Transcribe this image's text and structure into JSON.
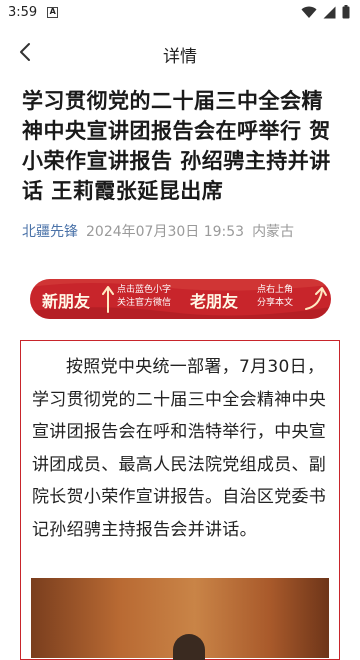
{
  "status_bar": {
    "time": "3:59",
    "notification_icon_letter": "A",
    "icons": [
      "wifi-icon",
      "signal-icon",
      "battery-icon"
    ]
  },
  "nav": {
    "title": "详情",
    "back_icon": "chevron-left-icon"
  },
  "article": {
    "title": "学习贯彻党的二十届三中全会精神中央宣讲团报告会在呼举行 贺小荣作宣讲报告 孙绍骋主持并讲话 王莉霞张延昆出席",
    "source": "北疆先锋",
    "date": "2024年07月30日 19:53",
    "region": "内蒙古"
  },
  "promo": {
    "new_friend": "新朋友",
    "new_friend_hint_1": "点击蓝色小字",
    "new_friend_hint_2": "关注官方微信",
    "old_friend": "老朋友",
    "old_friend_hint_1": "点右上角",
    "old_friend_hint_2": "分享本文"
  },
  "body": {
    "paragraph": "按照党中央统一部署，7月30日，学习贯彻党的二十届三中全会精神中央宣讲团报告会在呼和浩特举行，中央宣讲团成员、最高人民法院党组成员、副院长贺小荣作宣讲报告。自治区党委书记孙绍骋主持报告会并讲话。"
  },
  "colors": {
    "accent_red": "#c8252b",
    "source_blue": "#4a72a8",
    "meta_gray": "#9a9a9a"
  }
}
